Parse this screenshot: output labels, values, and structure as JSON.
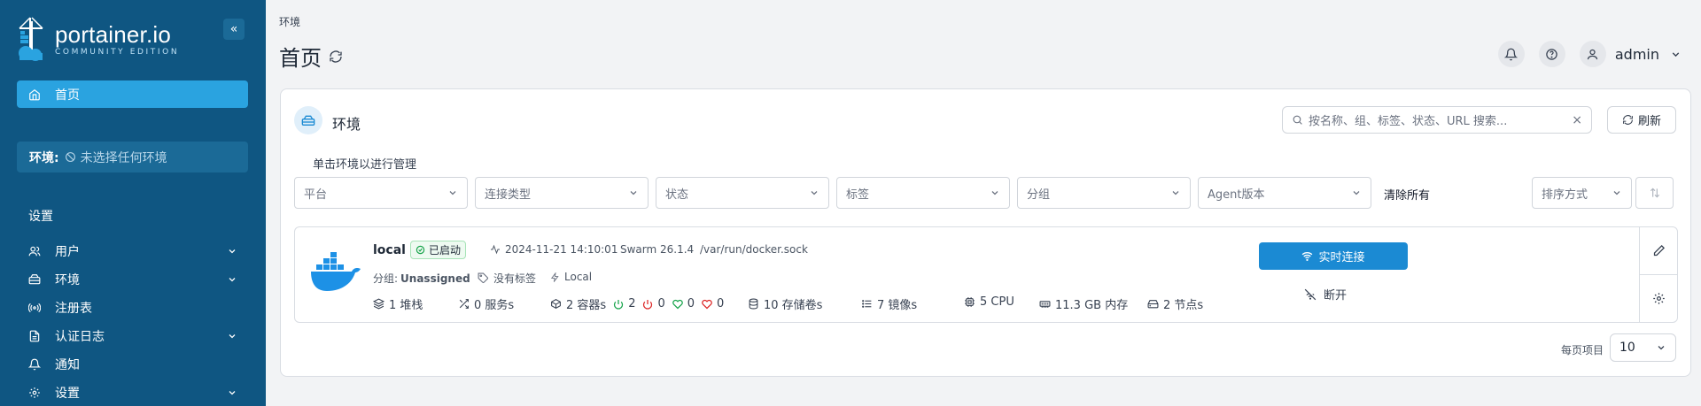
{
  "brand": {
    "title": "portainer.io",
    "subtitle": "COMMUNITY EDITION",
    "accent": "#0f5682",
    "active": "#2aa3e0"
  },
  "sidebar": {
    "collapse_label": "«",
    "home_label": "首页",
    "env_label": "环境:",
    "env_value": "未选择任何环境",
    "settings_title": "设置",
    "items": [
      {
        "label": "用户",
        "icon": "users-icon",
        "expandable": true
      },
      {
        "label": "环境",
        "icon": "server-icon",
        "expandable": true
      },
      {
        "label": "注册表",
        "icon": "radio-icon",
        "expandable": false
      },
      {
        "label": "认证日志",
        "icon": "file-icon",
        "expandable": true
      },
      {
        "label": "通知",
        "icon": "bell-icon",
        "expandable": false
      },
      {
        "label": "设置",
        "icon": "gear-icon",
        "expandable": true
      }
    ]
  },
  "header": {
    "breadcrumb": "环境",
    "title": "首页",
    "user": "admin"
  },
  "environments": {
    "title": "环境",
    "search_placeholder": "按名称、组、标签、状态、URL 搜索...",
    "refresh_label": "刷新",
    "hint": "单击环境以进行管理",
    "filters": [
      "平台",
      "连接类型",
      "状态",
      "标签",
      "分组",
      "Agent版本"
    ],
    "clear_all": "清除所有",
    "sort_label": "排序方式",
    "item": {
      "name": "local",
      "status": "已启动",
      "timestamp": "2024-11-21 14:10:01",
      "swarm": "Swarm 26.1.4",
      "socket": "/var/run/docker.sock",
      "group_label": "分组:",
      "group_value": "Unassigned",
      "tags": "没有标签",
      "location": "Local",
      "stacks": "1 堆栈",
      "services": "0 服务s",
      "containers": "2 容器s",
      "running": "2",
      "stopped": "0",
      "healthy": "0",
      "unhealthy": "0",
      "volumes": "10 存储卷s",
      "images": "7 镜像s",
      "cpu": "5 CPU",
      "memory": "11.3 GB 内存",
      "nodes": "2 节点s",
      "connect_label": "实时连接",
      "disconnect_label": "断开"
    },
    "per_page_label": "每页项目",
    "per_page_value": "10"
  }
}
